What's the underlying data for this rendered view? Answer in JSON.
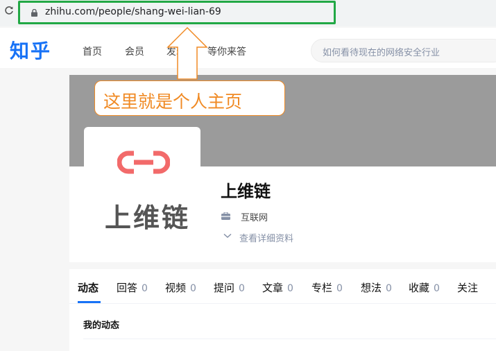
{
  "browser": {
    "url": "zhihu.com/people/shang-wei-lian-69"
  },
  "header": {
    "logo": "知乎",
    "nav": [
      "首页",
      "会员",
      "发现",
      "等你来答"
    ],
    "search_placeholder": "如何看待现在的网络安全行业"
  },
  "profile": {
    "avatar_text": "上维链",
    "name": "上维链",
    "industry": "互联网",
    "detail_link": "查看详细资料"
  },
  "tabs": [
    {
      "label": "动态",
      "count": ""
    },
    {
      "label": "回答",
      "count": "0"
    },
    {
      "label": "视频",
      "count": "0"
    },
    {
      "label": "提问",
      "count": "0"
    },
    {
      "label": "文章",
      "count": "0"
    },
    {
      "label": "专栏",
      "count": "0"
    },
    {
      "label": "想法",
      "count": "0"
    },
    {
      "label": "收藏",
      "count": "0"
    },
    {
      "label": "关注",
      "count": ""
    }
  ],
  "feed": {
    "title": "我的动态"
  },
  "annotation": {
    "text": "这里就是个人主页"
  },
  "colors": {
    "brand": "#1772f6",
    "annotation": "#f08a24",
    "url_highlight": "#22a845",
    "cover": "#9b9b9b",
    "avatar_link": "#f26a6a"
  }
}
